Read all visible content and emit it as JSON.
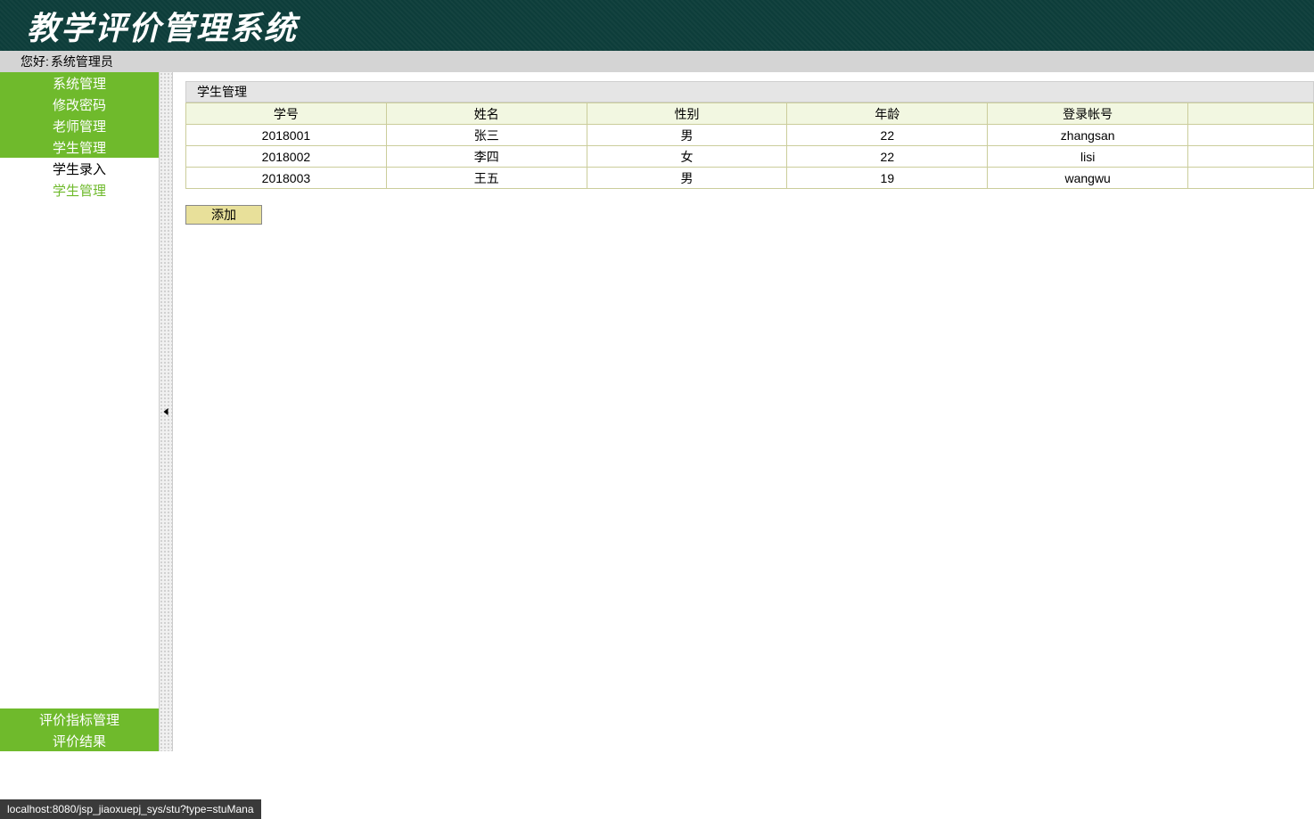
{
  "header": {
    "title": "教学评价管理系统"
  },
  "greeting": {
    "label": "您好:",
    "user": "系统管理员"
  },
  "sidebar": {
    "top": [
      {
        "label": "系统管理",
        "type": "section"
      },
      {
        "label": "修改密码",
        "type": "section"
      },
      {
        "label": "老师管理",
        "type": "section"
      },
      {
        "label": "学生管理",
        "type": "section"
      },
      {
        "label": "学生录入",
        "type": "sub",
        "active": false
      },
      {
        "label": "学生管理",
        "type": "sub",
        "active": true
      }
    ],
    "bottom": [
      {
        "label": "评价指标管理",
        "type": "section"
      },
      {
        "label": "评价结果",
        "type": "section"
      }
    ]
  },
  "panel": {
    "title": "学生管理"
  },
  "table": {
    "headers": [
      "学号",
      "姓名",
      "性别",
      "年龄",
      "登录帐号",
      ""
    ],
    "rows": [
      [
        "2018001",
        "张三",
        "男",
        "22",
        "zhangsan",
        ""
      ],
      [
        "2018002",
        "李四",
        "女",
        "22",
        "lisi",
        ""
      ],
      [
        "2018003",
        "王五",
        "男",
        "19",
        "wangwu",
        ""
      ]
    ]
  },
  "buttons": {
    "add": "添加"
  },
  "status": {
    "url": "localhost:8080/jsp_jiaoxuepj_sys/stu?type=stuMana"
  }
}
